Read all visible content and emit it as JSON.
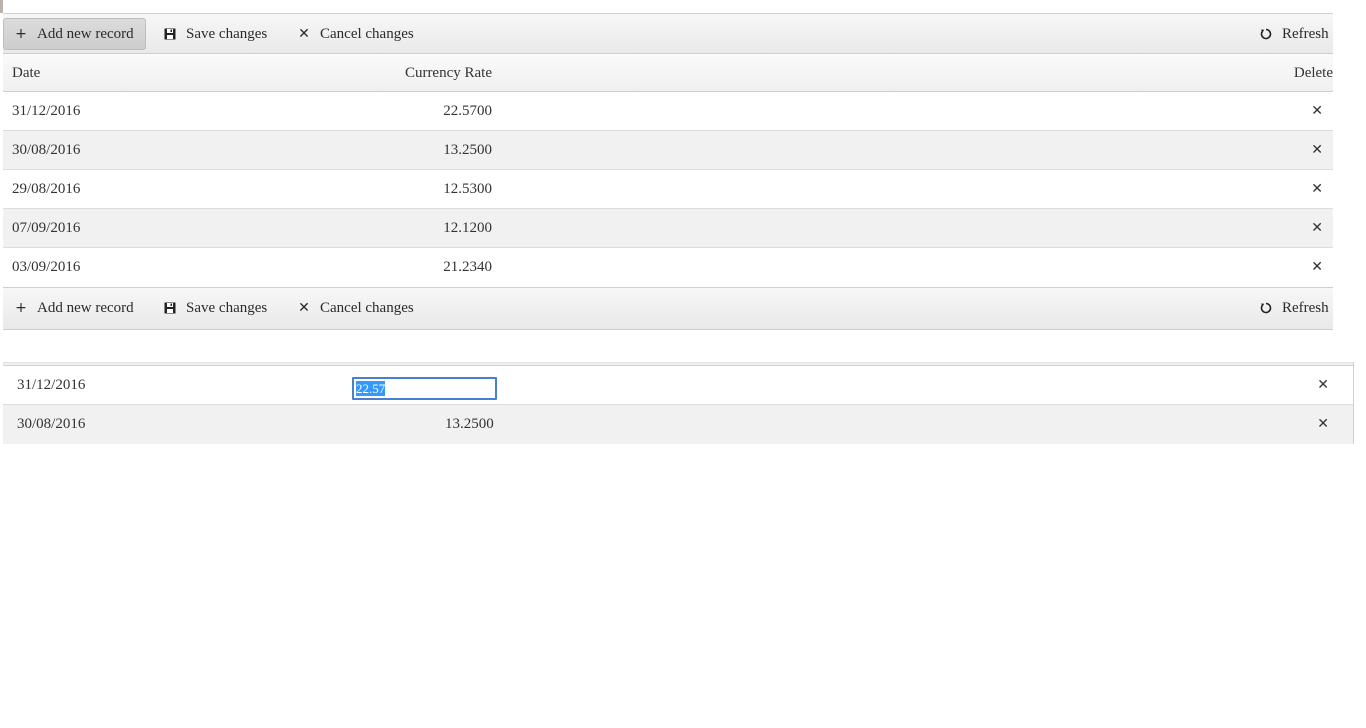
{
  "toolbar": {
    "add_label": "Add new record",
    "save_label": "Save changes",
    "cancel_label": "Cancel changes",
    "refresh_label": "Refresh"
  },
  "columns": {
    "date": "Date",
    "rate": "Currency Rate",
    "delete": "Delete"
  },
  "rows": [
    {
      "date": "31/12/2016",
      "rate": "22.5700"
    },
    {
      "date": "30/08/2016",
      "rate": "13.2500"
    },
    {
      "date": "29/08/2016",
      "rate": "12.5300"
    },
    {
      "date": "07/09/2016",
      "rate": "12.1200"
    },
    {
      "date": "03/09/2016",
      "rate": "21.2340"
    }
  ],
  "edit_grid": {
    "rows": [
      {
        "date": "31/12/2016",
        "rate_input_value": "22.57"
      },
      {
        "date": "30/08/2016",
        "rate": "13.2500"
      }
    ]
  },
  "icons": {
    "add": "plus-icon",
    "save": "floppy-disk-icon",
    "cancel": "close-icon",
    "refresh": "refresh-icon",
    "delete": "close-icon"
  },
  "colors": {
    "selection": "#3399ff",
    "input_border": "#4a7fd0",
    "alt_row": "#f1f1f1"
  }
}
